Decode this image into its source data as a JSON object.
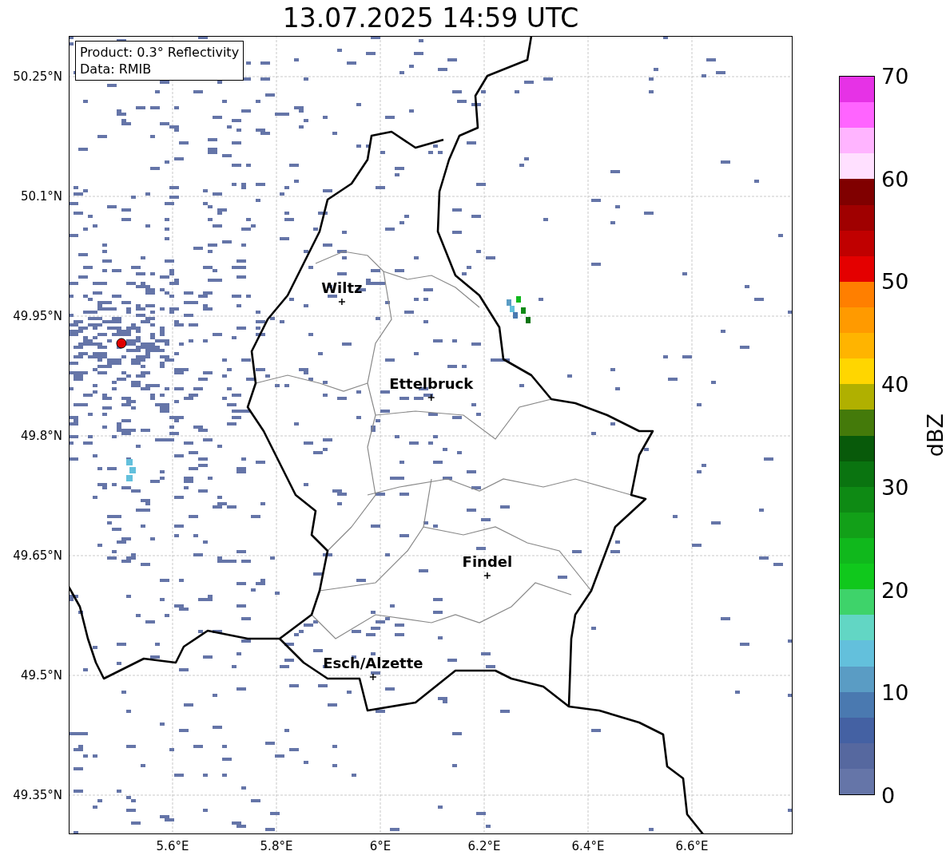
{
  "title": "13.07.2025 14:59 UTC",
  "info_box": [
    "Product: 0.3° Reflectivity",
    "Data: RMIB"
  ],
  "lat_ticks": [
    "50.25°N",
    "50.1°N",
    "49.95°N",
    "49.8°N",
    "49.65°N",
    "49.5°N",
    "49.35°N"
  ],
  "lon_ticks": [
    "5.6°E",
    "5.8°E",
    "6°E",
    "6.2°E",
    "6.4°E",
    "6.6°E"
  ],
  "cities": [
    {
      "name": "Wiltz"
    },
    {
      "name": "Ettelbruck"
    },
    {
      "name": "Findel"
    },
    {
      "name": "Esch/Alzette"
    }
  ],
  "colorbar": {
    "label": "dBZ",
    "ticks": [
      "70",
      "60",
      "50",
      "40",
      "30",
      "20",
      "10",
      "0"
    ],
    "segments": [
      {
        "color": "#e632e6"
      },
      {
        "color": "#ff64ff"
      },
      {
        "color": "#ffb4ff"
      },
      {
        "color": "#ffe0ff"
      },
      {
        "color": "#800000"
      },
      {
        "color": "#a00000"
      },
      {
        "color": "#c00000"
      },
      {
        "color": "#e40000"
      },
      {
        "color": "#ff7f00"
      },
      {
        "color": "#ff9a00"
      },
      {
        "color": "#ffb400"
      },
      {
        "color": "#ffd600"
      },
      {
        "color": "#b0b000"
      },
      {
        "color": "#447a0a"
      },
      {
        "color": "#085a0a"
      },
      {
        "color": "#0a7410"
      },
      {
        "color": "#0e8a14"
      },
      {
        "color": "#12a018"
      },
      {
        "color": "#10b81c"
      },
      {
        "color": "#10c81c"
      },
      {
        "color": "#3ed36a"
      },
      {
        "color": "#62d6c4"
      },
      {
        "color": "#63c0dc"
      },
      {
        "color": "#5a9cc4"
      },
      {
        "color": "#4a79b0"
      },
      {
        "color": "#4461a3"
      },
      {
        "color": "#56689f"
      },
      {
        "color": "#6575a8"
      }
    ]
  }
}
